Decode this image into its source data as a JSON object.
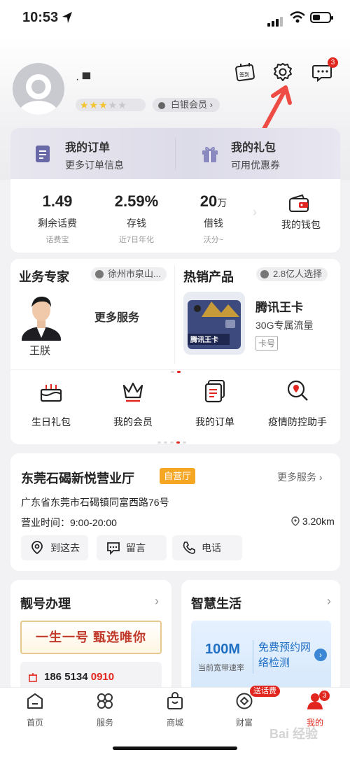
{
  "status_bar": {
    "time": "10:53"
  },
  "header": {
    "username": "·  ▀",
    "stars": {
      "filled": 3,
      "total": 5
    },
    "member_label": "白银会员",
    "checkin_label": "签到",
    "message_badge": "3"
  },
  "orders_card": {
    "orders_title": "我的订单",
    "orders_sub": "更多订单信息",
    "gifts_title": "我的礼包",
    "gifts_sub": "可用优惠券",
    "stats": [
      {
        "value": "1.49",
        "unit": "",
        "label": "剩余话费",
        "sub": "话费宝"
      },
      {
        "value": "2.59%",
        "unit": "",
        "label": "存钱",
        "sub": "近7日年化"
      },
      {
        "value": "20",
        "unit": "万",
        "label": "借钱",
        "sub": "沃分~"
      }
    ],
    "wallet_label": "我的钱包"
  },
  "expert_card": {
    "expert_title": "业务专家",
    "location": "徐州市泉山...",
    "expert_name": "王朕",
    "more_services": "更多服务",
    "hot_title": "热销产品",
    "hot_chip": "2.8亿人选择",
    "product_name": "腾讯王卡",
    "product_sub": "30G专属流量",
    "product_tag": "卡号",
    "card_art_text": "腾讯王卡",
    "quick_actions": [
      {
        "label": "生日礼包",
        "icon": "cake-icon"
      },
      {
        "label": "我的会员",
        "icon": "crown-icon"
      },
      {
        "label": "我的订单",
        "icon": "orders-icon"
      },
      {
        "label": "疫情防控助手",
        "icon": "location-search-icon"
      }
    ]
  },
  "store_card": {
    "name": "东莞石碣新悦营业厅",
    "tag": "自营厅",
    "more": "更多服务",
    "address": "广东省东莞市石碣镇同富西路76号",
    "hours": "营业时间：9:00-20:00",
    "distance": "3.20km",
    "actions": [
      "到这去",
      "留言",
      "电话"
    ]
  },
  "number_card": {
    "title": "靓号办理",
    "slogan": "一生一号 甄选唯你",
    "phone_prefix": "186 5134 ",
    "phone_suffix": "0910"
  },
  "life_card": {
    "title": "智慧生活",
    "speed": "100M",
    "speed_label": "当前宽带速率",
    "cta": "免费预约网络检测"
  },
  "tabbar": {
    "items": [
      "首页",
      "服务",
      "商城",
      "财富",
      "我的"
    ],
    "promo": "送话费",
    "mine_badge": "3"
  },
  "watermark": "Bai 经验",
  "colors": {
    "accent": "#e0261e",
    "orange": "#f5a623",
    "blue": "#1f6fc4"
  }
}
